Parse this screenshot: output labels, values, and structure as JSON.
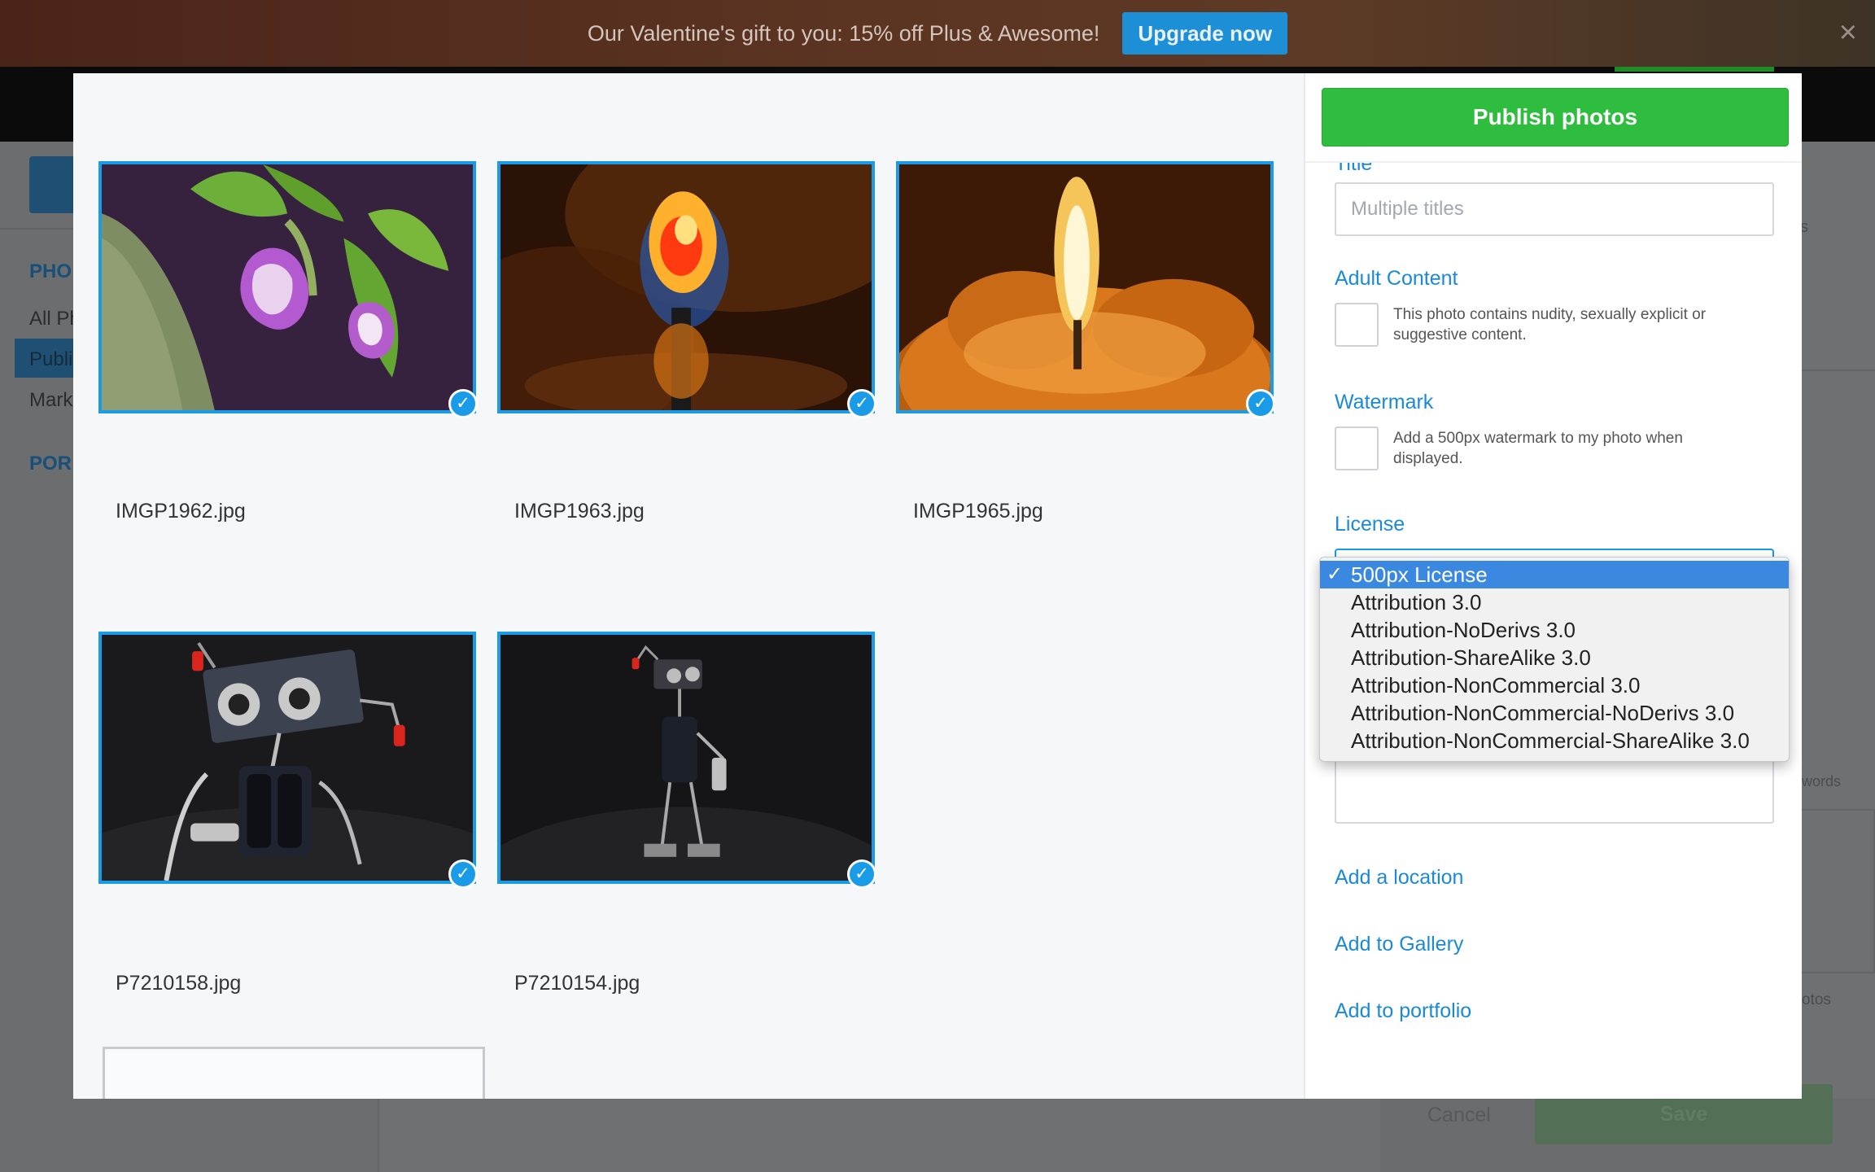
{
  "promo": {
    "text": "Our Valentine's gift to you: 15% off Plus & Awesome!",
    "button": "Upgrade now",
    "close": "×"
  },
  "background": {
    "sidebar_heading_1": "PHO",
    "sidebar_item_1": "All Ph",
    "sidebar_item_2": "Publi",
    "sidebar_item_3": "Mark",
    "sidebar_heading_2": "POR",
    "right_fragment_1": "s",
    "right_fragment_2": "words",
    "right_fragment_3": "otos",
    "cancel": "Cancel",
    "save": "Save"
  },
  "photos": [
    {
      "filename": "IMGP1962.jpg",
      "subject": "purple-flower",
      "selected": true
    },
    {
      "filename": "IMGP1963.jpg",
      "subject": "blue-flame",
      "selected": true
    },
    {
      "filename": "IMGP1965.jpg",
      "subject": "candle",
      "selected": true
    },
    {
      "filename": "P7210158.jpg",
      "subject": "wire-robot-closeup",
      "selected": true
    },
    {
      "filename": "P7210154.jpg",
      "subject": "wire-robot-full",
      "selected": true
    }
  ],
  "check_glyph": "✓",
  "panel": {
    "publish_button": "Publish photos",
    "title_label": "Title",
    "title_placeholder": "Multiple titles",
    "adult_label": "Adult Content",
    "adult_desc": "This photo contains nudity, sexually explicit or suggestive content.",
    "watermark_label": "Watermark",
    "watermark_desc": "Add a 500px watermark to my photo when displayed.",
    "license_label": "License",
    "add_location": "Add a location",
    "add_gallery": "Add to Gallery",
    "add_portfolio": "Add to portfolio"
  },
  "license_dropdown": {
    "selected": "500px License",
    "selected_mark": "✓",
    "options": [
      "500px License",
      "Attribution 3.0",
      "Attribution-NoDerivs 3.0",
      "Attribution-ShareAlike 3.0",
      "Attribution-NonCommercial 3.0",
      "Attribution-NonCommercial-NoDerivs 3.0",
      "Attribution-NonCommercial-ShareAlike 3.0"
    ]
  },
  "colors": {
    "accent": "#1a9be8",
    "publish_green": "#2fbd3f",
    "link_blue": "#1b8ad6",
    "selected_option": "#3b88e0"
  }
}
